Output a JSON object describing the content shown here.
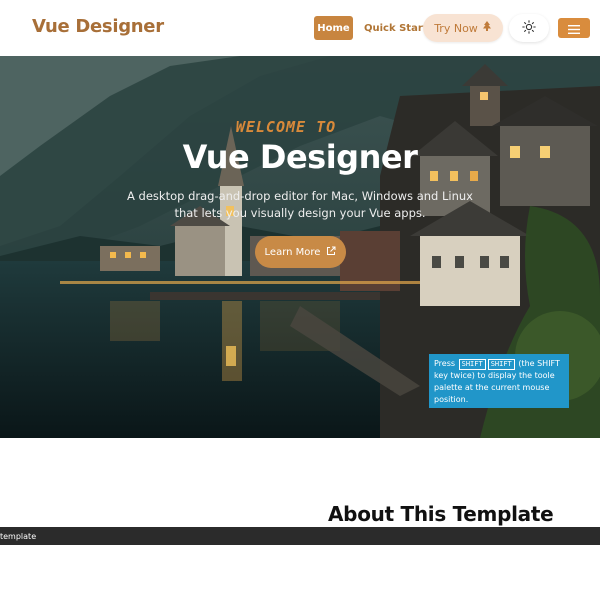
{
  "header": {
    "brand": "Vue Designer",
    "nav": {
      "home_label": "Home",
      "quick_start_label": "Quick Start",
      "try_now_label": "Try Now"
    },
    "icons": {
      "try_now": "tree-icon",
      "theme": "sun-icon",
      "menu": "hamburger-icon"
    }
  },
  "hero": {
    "welcome": "WELCOME TO",
    "title": "Vue Designer",
    "subtitle": "A desktop drag-and-drop editor for Mac, Windows and Linux that lets you visually design your Vue apps.",
    "learn_more_label": "Learn More",
    "learn_more_icon": "external-link-icon"
  },
  "tooltip": {
    "prefix": "Press",
    "key1": "SHIFT",
    "key2": "SHIFT",
    "text": "(the SHIFT key twice) to display the toole palette at the current mouse position."
  },
  "about": {
    "title": "About This Template"
  },
  "status_bar": {
    "text": "template"
  },
  "colors": {
    "brand": "#a86f38",
    "accent": "#c8853f",
    "tooltip": "#2196c9"
  }
}
